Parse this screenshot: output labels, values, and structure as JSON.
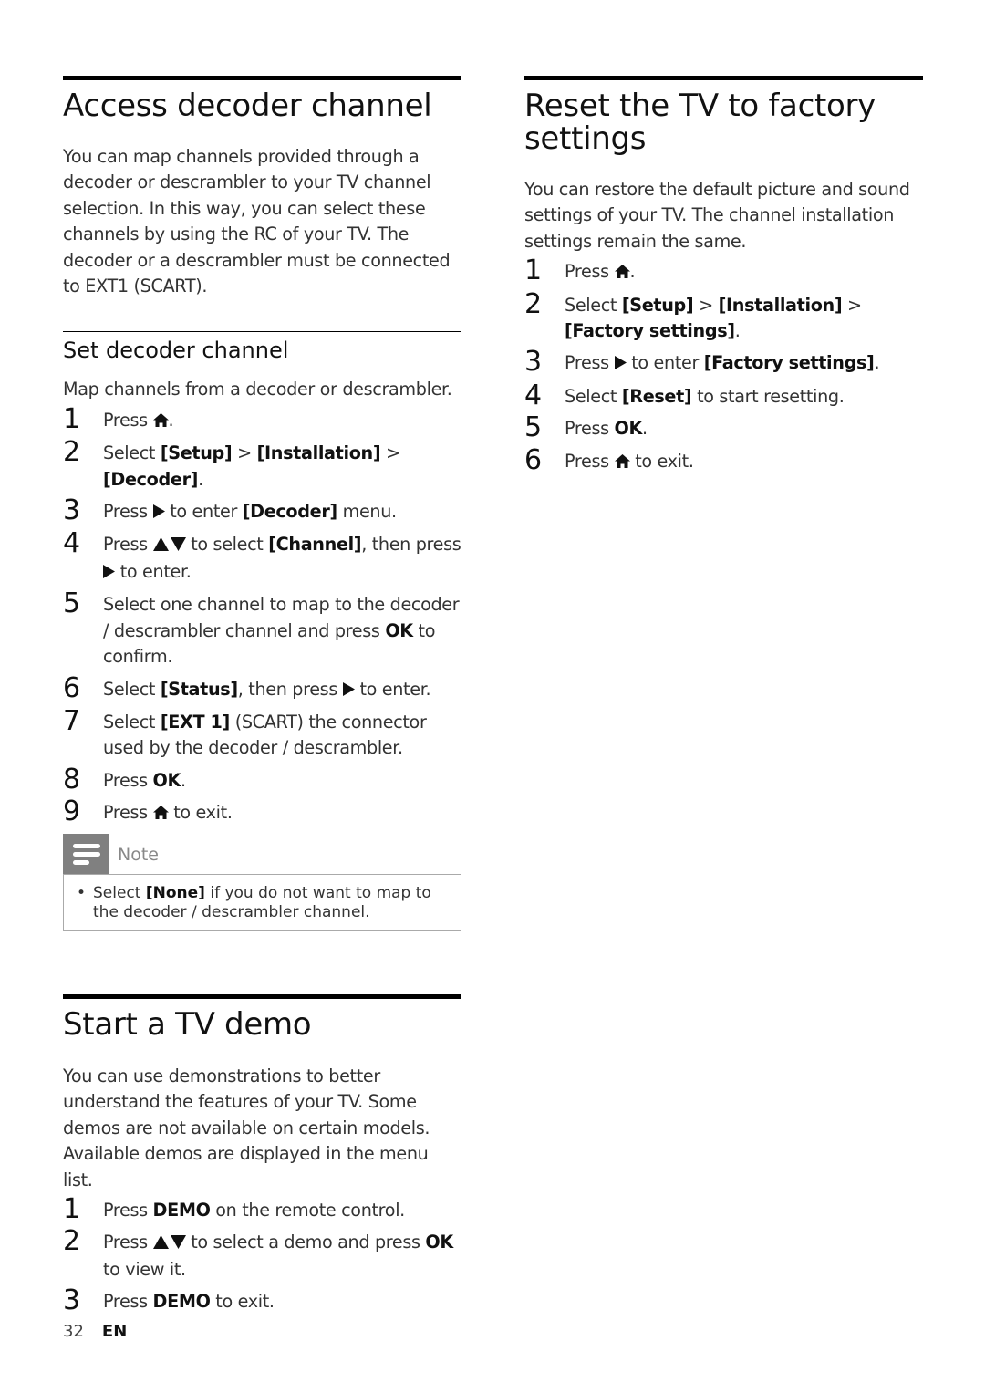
{
  "left": {
    "decoder": {
      "title": "Access decoder channel",
      "intro": "You can map channels provided through a decoder or descrambler to your TV channel selection. In this way, you can select these channels by using the RC of your TV. The decoder or a descrambler must be connected to EXT1 (SCART).",
      "sub_title": "Set decoder channel",
      "sub_intro": "Map channels from a decoder or descrambler.",
      "steps": [
        {
          "num": "1",
          "parts": [
            {
              "t": "Press "
            },
            {
              "icon": "home"
            },
            {
              "t": "."
            }
          ]
        },
        {
          "num": "2",
          "parts": [
            {
              "t": "Select "
            },
            {
              "b": "[Setup]"
            },
            {
              "t": " > "
            },
            {
              "b": "[Installation]"
            },
            {
              "t": " > "
            },
            {
              "b": "[Decoder]"
            },
            {
              "t": "."
            }
          ]
        },
        {
          "num": "3",
          "parts": [
            {
              "t": "Press "
            },
            {
              "icon": "right"
            },
            {
              "t": " to enter "
            },
            {
              "b": "[Decoder]"
            },
            {
              "t": " menu."
            }
          ]
        },
        {
          "num": "4",
          "parts": [
            {
              "t": "Press "
            },
            {
              "icon": "updown"
            },
            {
              "t": " to select "
            },
            {
              "b": "[Channel]"
            },
            {
              "t": ", then press "
            },
            {
              "icon": "right"
            },
            {
              "t": " to enter."
            }
          ]
        },
        {
          "num": "5",
          "parts": [
            {
              "t": "Select one channel to map to the decoder / descrambler channel and press "
            },
            {
              "b": "OK"
            },
            {
              "t": " to confirm."
            }
          ]
        },
        {
          "num": "6",
          "parts": [
            {
              "t": "Select "
            },
            {
              "b": "[Status]"
            },
            {
              "t": ", then press "
            },
            {
              "icon": "right"
            },
            {
              "t": " to enter."
            }
          ]
        },
        {
          "num": "7",
          "parts": [
            {
              "t": "Select "
            },
            {
              "b": "[EXT 1]"
            },
            {
              "t": " (SCART) the connector used by the decoder / descrambler."
            }
          ]
        },
        {
          "num": "8",
          "parts": [
            {
              "t": "Press "
            },
            {
              "b": "OK"
            },
            {
              "t": "."
            }
          ]
        },
        {
          "num": "9",
          "parts": [
            {
              "t": "Press "
            },
            {
              "icon": "home"
            },
            {
              "t": " to exit."
            }
          ]
        }
      ],
      "note": {
        "label": "Note",
        "items": [
          {
            "parts": [
              {
                "t": "Select "
              },
              {
                "b": "[None]"
              },
              {
                "t": " if you do not want to map to the decoder / descrambler channel."
              }
            ]
          }
        ]
      }
    },
    "demo": {
      "title": "Start a TV demo",
      "intro": "You can use demonstrations to better understand the features of your TV. Some demos are not available on certain models. Available demos are displayed in the menu list.",
      "steps": [
        {
          "num": "1",
          "parts": [
            {
              "t": "Press "
            },
            {
              "b": "DEMO"
            },
            {
              "t": " on the remote control."
            }
          ]
        },
        {
          "num": "2",
          "parts": [
            {
              "t": "Press "
            },
            {
              "icon": "updown"
            },
            {
              "t": " to select a demo and press "
            },
            {
              "b": "OK"
            },
            {
              "t": " to view it."
            }
          ]
        },
        {
          "num": "3",
          "parts": [
            {
              "t": "Press "
            },
            {
              "b": "DEMO"
            },
            {
              "t": " to exit."
            }
          ]
        }
      ]
    }
  },
  "right": {
    "reset": {
      "title": "Reset the TV to factory settings",
      "intro": "You can restore the default picture and sound settings of your TV. The channel installation settings remain the same.",
      "steps": [
        {
          "num": "1",
          "parts": [
            {
              "t": "Press "
            },
            {
              "icon": "home"
            },
            {
              "t": "."
            }
          ]
        },
        {
          "num": "2",
          "parts": [
            {
              "t": "Select "
            },
            {
              "b": "[Setup]"
            },
            {
              "t": " > "
            },
            {
              "b": "[Installation]"
            },
            {
              "t": " > "
            },
            {
              "b": "[Factory settings]"
            },
            {
              "t": "."
            }
          ]
        },
        {
          "num": "3",
          "parts": [
            {
              "t": "Press "
            },
            {
              "icon": "right"
            },
            {
              "t": " to enter "
            },
            {
              "b": "[Factory settings]"
            },
            {
              "t": "."
            }
          ]
        },
        {
          "num": "4",
          "parts": [
            {
              "t": "Select "
            },
            {
              "b": "[Reset]"
            },
            {
              "t": " to start resetting."
            }
          ]
        },
        {
          "num": "5",
          "parts": [
            {
              "t": "Press "
            },
            {
              "b": "OK"
            },
            {
              "t": "."
            }
          ]
        },
        {
          "num": "6",
          "parts": [
            {
              "t": "Press "
            },
            {
              "icon": "home"
            },
            {
              "t": " to exit."
            }
          ]
        }
      ]
    }
  },
  "footer": {
    "page_number": "32",
    "language": "EN"
  },
  "icons": {
    "home": "🏠",
    "right": "▶",
    "updown": "▲▼"
  }
}
